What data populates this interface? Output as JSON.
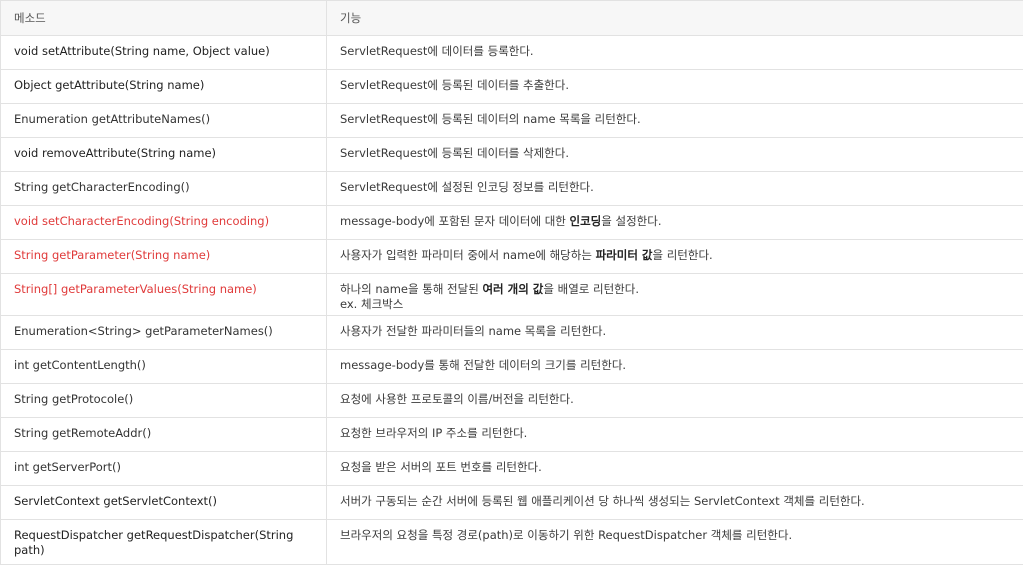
{
  "table": {
    "headers": [
      "메소드",
      "기능"
    ],
    "rows": [
      {
        "method": "void setAttribute(String name, Object value)",
        "style": "bold",
        "desc": "ServletRequest에 데이터를 등록한다."
      },
      {
        "method": "Object getAttribute(String name)",
        "style": "bold",
        "desc": "ServletRequest에 등록된 데이터를 추출한다."
      },
      {
        "method": "Enumeration getAttributeNames()",
        "style": "normal",
        "desc": "ServletRequest에 등록된 데이터의 name 목록을 리턴한다."
      },
      {
        "method": "void removeAttribute(String name)",
        "style": "bold",
        "desc": "ServletRequest에 등록된 데이터를 삭제한다."
      },
      {
        "method": "String getCharacterEncoding()",
        "style": "normal",
        "desc": "ServletRequest에 설정된 인코딩 정보를 리턴한다."
      },
      {
        "method": "void setCharacterEncoding(String encoding)",
        "style": "red",
        "desc_pre": "message-body에 포함된 문자 데이터에 대한 ",
        "desc_bold": "인코딩",
        "desc_post": "을 설정한다."
      },
      {
        "method": "String getParameter(String name)",
        "style": "red",
        "desc_pre": "사용자가 입력한 파라미터 중에서 name에 해당하는 ",
        "desc_bold": "파라미터 값",
        "desc_post": "을 리턴한다."
      },
      {
        "method": "String[] getParameterValues(String name)",
        "style": "red",
        "desc_pre": "하나의 name을 통해 전달된 ",
        "desc_bold": "여러 개의 값",
        "desc_post": "을 배열로 리턴한다.",
        "desc_line2": "ex. 체크박스"
      },
      {
        "method": "Enumeration<String> getParameterNames()",
        "style": "normal",
        "desc": "사용자가 전달한 파라미터들의 name 목록을 리턴한다."
      },
      {
        "method": "int getContentLength()",
        "style": "normal",
        "desc": "message-body를 통해 전달한 데이터의 크기를 리턴한다."
      },
      {
        "method": "String getProtocole()",
        "style": "normal",
        "desc": "요청에 사용한 프로토콜의 이름/버전을 리턴한다."
      },
      {
        "method": "String getRemoteAddr()",
        "style": "normal",
        "desc": "요청한 브라우저의 IP 주소를 리턴한다."
      },
      {
        "method": "int getServerPort()",
        "style": "normal",
        "desc": "요청을 받은 서버의 포트 번호를 리턴한다."
      },
      {
        "method": "ServletContext getServletContext()",
        "style": "bold",
        "desc": "서버가 구동되는 순간 서버에 등록된 웹 애플리케이션 당 하나씩 생성되는 ServletContext 객체를 리턴한다."
      },
      {
        "method": "RequestDispatcher getRequestDispatcher(String path)",
        "style": "bold",
        "desc": "브라우저의 요청을 특정 경로(path)로 이동하기 위한 RequestDispatcher 객체를 리턴한다."
      }
    ]
  }
}
